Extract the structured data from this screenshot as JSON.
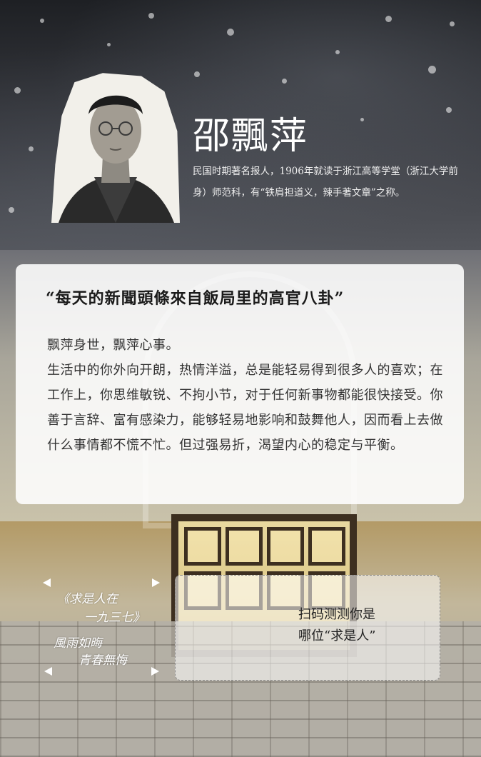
{
  "header": {
    "name": "邵飄萍",
    "intro": "民国时期著名报人，1906年就读于浙江高等学堂（浙江大学前身）师范科，有“铁肩担道义，辣手著文章”之称。"
  },
  "card": {
    "quote": "“每天的新聞頭條來自飯局里的高官八卦”",
    "paragraphs": [
      "飘萍身世，飘萍心事。",
      "生活中的你外向开朗，热情洋溢，总是能轻易得到很多人的喜欢；在工作上，你思维敏锐、不拘小节，对于任何新事物都能很快接受。你善于言辞、富有感染力，能够轻易地影响和鼓舞他人，因而看上去做什么事情都不慌不忙。但过强易折，渴望内心的稳定与平衡。"
    ]
  },
  "handwriting": {
    "line1": "《求是人在",
    "line2": "一九三七》",
    "line3": "風雨如晦",
    "line4": "青春無悔"
  },
  "qr_box": {
    "line1": "扫码测测你是",
    "line2": "哪位“求是人”"
  }
}
